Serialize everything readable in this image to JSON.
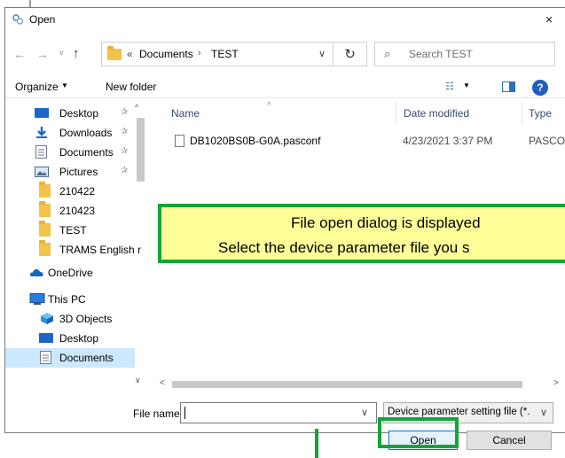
{
  "dialog": {
    "title": "Open",
    "close_glyph": "×"
  },
  "nav": {
    "back_glyph": "←",
    "forward_glyph": "→",
    "recent_glyph": "∨",
    "up_glyph": "↑",
    "address_chevron": "«",
    "address_segments": [
      "Documents",
      "TEST"
    ],
    "address_separator": "›",
    "address_dropdown": "∨",
    "refresh_glyph": "↻",
    "search_placeholder": "Search TEST",
    "search_glyph": "⌕"
  },
  "toolbar": {
    "organize_label": "Organize",
    "organize_caret": "▼",
    "new_folder_label": "New folder",
    "view_glyph": "☷",
    "view_caret": "▼",
    "help_glyph": "?"
  },
  "sidebar": {
    "scroll_up": "^",
    "scroll_down": "∨",
    "pin_glyph": "✰",
    "items": [
      {
        "label": "Desktop",
        "icon": "desktop-icon",
        "pinned": true
      },
      {
        "label": "Downloads",
        "icon": "downloads-icon",
        "pinned": true
      },
      {
        "label": "Documents",
        "icon": "documents-icon",
        "pinned": true
      },
      {
        "label": "Pictures",
        "icon": "pictures-icon",
        "pinned": true
      },
      {
        "label": "210422",
        "icon": "folder-icon"
      },
      {
        "label": "210423",
        "icon": "folder-icon"
      },
      {
        "label": "TEST",
        "icon": "folder-icon"
      },
      {
        "label": "TRAMS English r",
        "icon": "folder-icon"
      },
      {
        "label": "OneDrive",
        "icon": "onedrive-icon"
      },
      {
        "label": "This PC",
        "icon": "this-pc-icon"
      },
      {
        "label": "3D Objects",
        "icon": "3d-objects-icon"
      },
      {
        "label": "Desktop",
        "icon": "desktop-icon"
      },
      {
        "label": "Documents",
        "icon": "documents-icon",
        "selected": true
      }
    ]
  },
  "file_list": {
    "sort_glyph": "^",
    "columns": [
      "Name",
      "Date modified",
      "Type"
    ],
    "rows": [
      {
        "name": "DB1020BS0B-G0A.pasconf",
        "date": "4/23/2021 3:37 PM",
        "type": "PASCON"
      }
    ],
    "hscroll_left": "<",
    "hscroll_right": ">"
  },
  "footer": {
    "file_name_label": "File name:",
    "file_name_value": "",
    "file_name_dropdown": "∨",
    "filter_value": "Device parameter setting file (*.",
    "filter_dropdown": "∨",
    "open_label": "Open",
    "cancel_label": "Cancel"
  },
  "annotation": {
    "line1": "File open dialog is displayed",
    "line2": "Select the device parameter file you s"
  },
  "colors": {
    "highlight_green": "#12a538",
    "callout_yellow": "#ffff99",
    "selection_blue": "#cce8ff",
    "accent_blue": "#0078d7"
  }
}
